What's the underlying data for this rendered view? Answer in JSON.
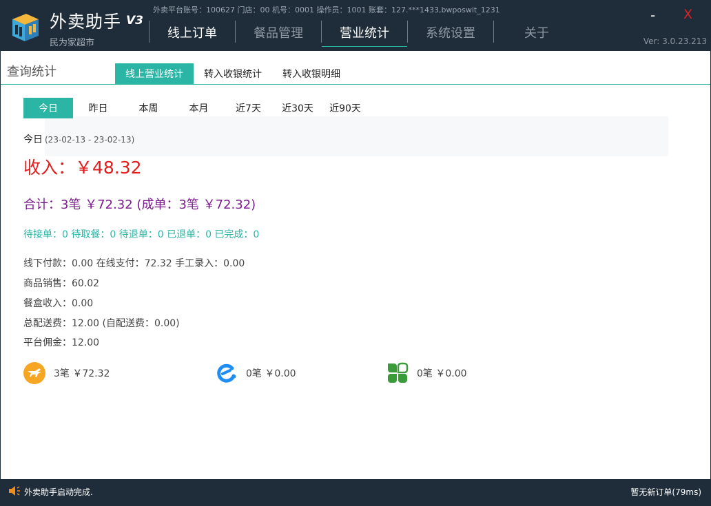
{
  "app": {
    "title": "外卖助手",
    "version_badge": "V3",
    "subtitle": "民为家超市",
    "account_info": "外卖平台账号：100627 门店：00 机号：0001 操作员：1001 账套：127.***1433,bwposwit_1231",
    "version": "Ver: 3.0.23.213",
    "minimize": "-",
    "close": "X"
  },
  "nav": [
    {
      "label": "线上订单"
    },
    {
      "label": "餐品管理"
    },
    {
      "label": "营业统计"
    },
    {
      "label": "系统设置"
    },
    {
      "label": "关于"
    }
  ],
  "page": {
    "section_title": "查询统计",
    "sub_tabs": [
      {
        "label": "线上营业统计"
      },
      {
        "label": "转入收银统计"
      },
      {
        "label": "转入收银明细"
      }
    ],
    "range_tabs": [
      {
        "label": "今日"
      },
      {
        "label": "昨日"
      },
      {
        "label": "本周"
      },
      {
        "label": "本月"
      },
      {
        "label": "近7天"
      },
      {
        "label": "近30天"
      },
      {
        "label": "近90天"
      }
    ],
    "date_label": "今日",
    "date_range": "(23-02-13 - 23-02-13)",
    "income": "收入：￥48.32",
    "total": "合计：3笔 ￥72.32 (成单：3笔 ￥72.32)",
    "status_counts": "待接单：0 待取餐：0 待退单：0 已退单：0 已完成：0",
    "details": [
      "线下付款：0.00 在线支付：72.32 手工录入：0.00",
      "商品销售：60.02",
      "餐盒收入：0.00",
      "总配送费：12.00 (自配送费：0.00)",
      "平台佣金：12.00"
    ],
    "platforms": [
      {
        "icon": "meituan-kangaroo-icon",
        "summary": "3笔 ￥72.32",
        "color": "#f6a623"
      },
      {
        "icon": "eleme-icon",
        "summary": "0笔 ￥0.00",
        "color": "#1e8ef5"
      },
      {
        "icon": "clover-icon",
        "summary": "0笔 ￥0.00",
        "color": "#3a9b3a"
      }
    ]
  },
  "statusbar": {
    "message": "外卖助手启动完成.",
    "right": "暂无新订单(79ms)"
  },
  "colors": {
    "accent": "#2bb5a5",
    "header_bg": "#1f2d3a",
    "income": "#e11d1d",
    "total": "#7a1b8c"
  }
}
